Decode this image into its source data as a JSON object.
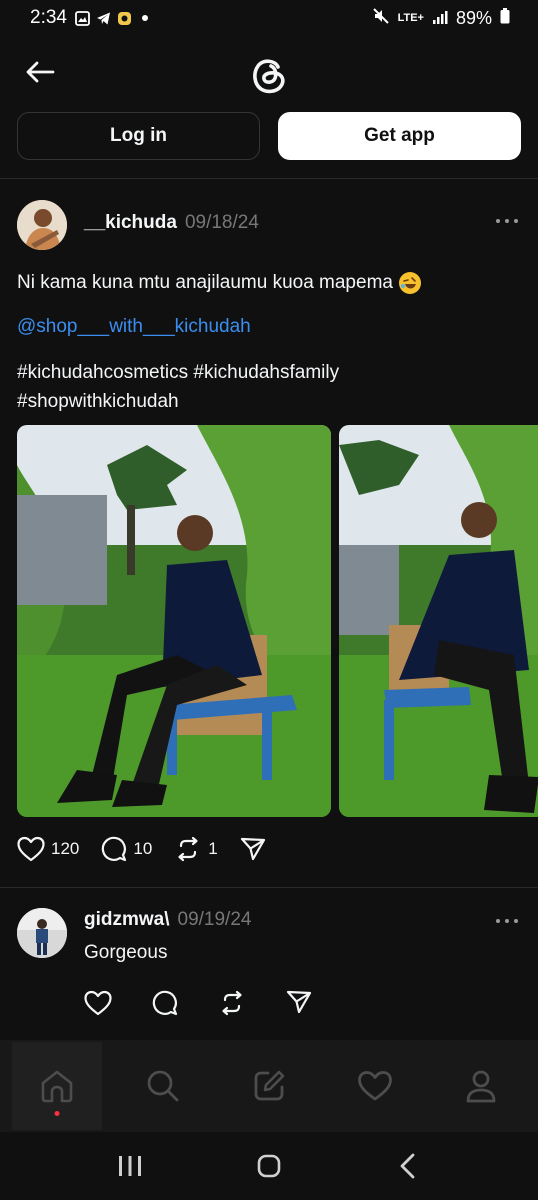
{
  "status_bar": {
    "time": "2:34",
    "network": "LTE+",
    "battery": "89%"
  },
  "header": {
    "login_label": "Log in",
    "getapp_label": "Get app"
  },
  "post": {
    "username": "__kichuda",
    "timestamp": "09/18/24",
    "text": "Ni kama kuna mtu anajilaumu kuoa mapema",
    "mention": "@shop___with___kichudah",
    "hashtags": [
      "#kichudahcosmetics",
      "#kichudahsfamily",
      "#shopwithkichudah"
    ],
    "likes": "120",
    "replies": "10",
    "reposts": "1"
  },
  "reply": {
    "username": "gidzmwa\\",
    "timestamp": "09/19/24",
    "text": "Gorgeous"
  },
  "colors": {
    "background": "#101010",
    "link": "#3b8ef0",
    "muted": "#777777",
    "active_dot": "#ff3040"
  },
  "icons": {
    "tabs": [
      "home-icon",
      "search-icon",
      "compose-icon",
      "heart-icon",
      "profile-icon"
    ],
    "system": [
      "recents-icon",
      "home-circle-icon",
      "back-chevron-icon"
    ]
  }
}
